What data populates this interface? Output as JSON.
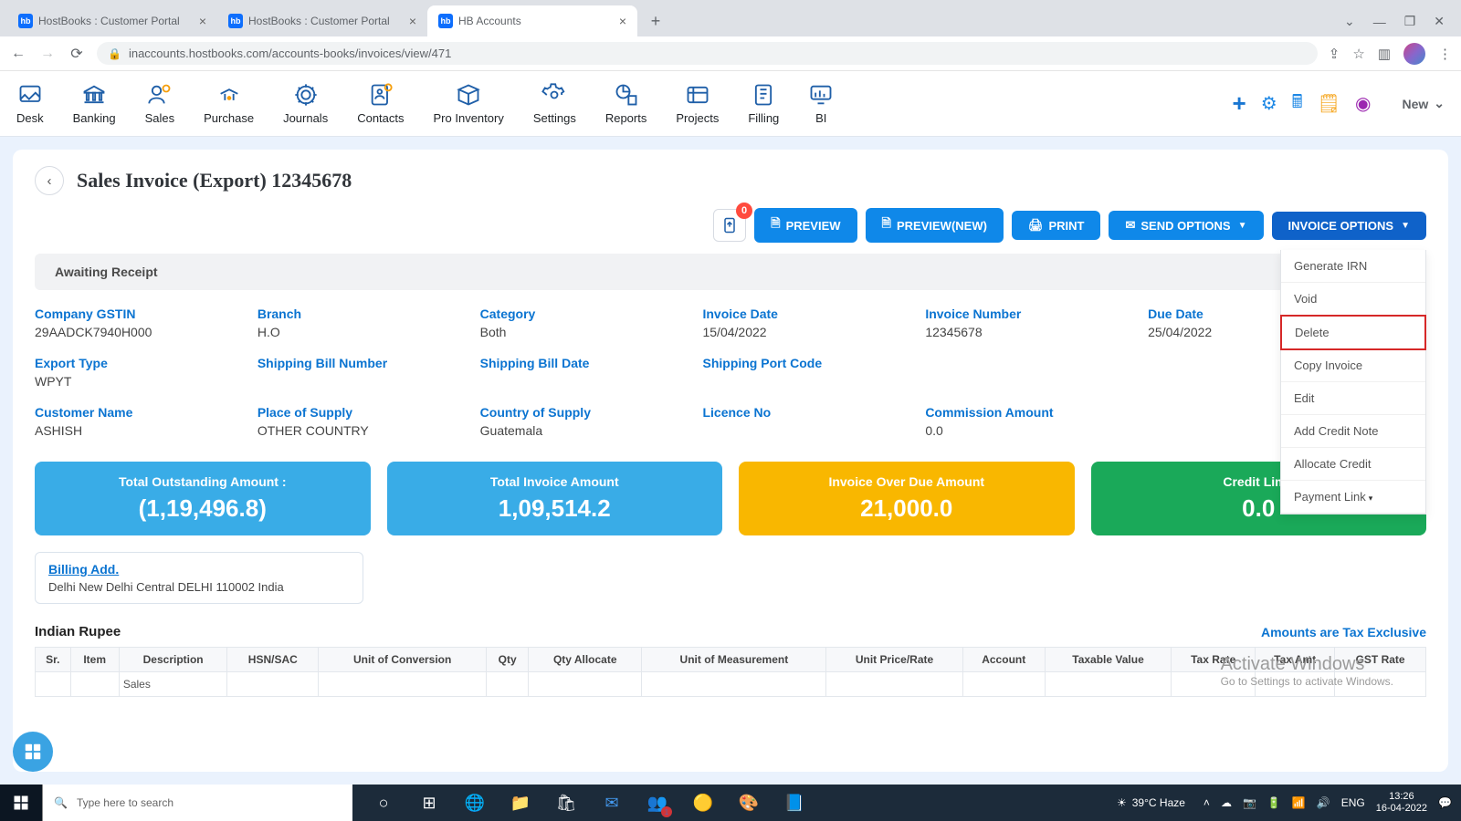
{
  "browser": {
    "tabs": [
      {
        "title": "HostBooks : Customer Portal"
      },
      {
        "title": "HostBooks : Customer Portal"
      },
      {
        "title": "HB Accounts"
      }
    ],
    "url": "inaccounts.hostbooks.com/accounts-books/invoices/view/471"
  },
  "top_nav": {
    "items": [
      "Desk",
      "Banking",
      "Sales",
      "Purchase",
      "Journals",
      "Contacts",
      "Pro Inventory",
      "Settings",
      "Reports",
      "Projects",
      "Filling",
      "BI"
    ],
    "new_label": "New"
  },
  "page": {
    "title": "Sales Invoice (Export) 12345678",
    "attach_badge": "0",
    "buttons": {
      "preview": "PREVIEW",
      "preview_new": "PREVIEW(NEW)",
      "print": "PRINT",
      "send": "SEND OPTIONS",
      "options": "INVOICE OPTIONS"
    },
    "dropdown": [
      "Generate IRN",
      "Void",
      "Delete",
      "Copy Invoice",
      "Edit",
      "Add Credit Note",
      "Allocate Credit",
      "Payment Link"
    ],
    "status": "Awaiting Receipt",
    "fields": {
      "company_gstin": {
        "l": "Company GSTIN",
        "v": "29AADCK7940H000"
      },
      "branch": {
        "l": "Branch",
        "v": "H.O"
      },
      "category": {
        "l": "Category",
        "v": "Both"
      },
      "invoice_date": {
        "l": "Invoice Date",
        "v": "15/04/2022"
      },
      "invoice_number": {
        "l": "Invoice Number",
        "v": "12345678"
      },
      "due_date": {
        "l": "Due Date",
        "v": "25/04/2022"
      },
      "export_type": {
        "l": "Export Type",
        "v": "WPYT"
      },
      "ship_bill_no": {
        "l": "Shipping Bill Number",
        "v": ""
      },
      "ship_bill_date": {
        "l": "Shipping Bill Date",
        "v": ""
      },
      "ship_port": {
        "l": "Shipping Port Code",
        "v": ""
      },
      "customer": {
        "l": "Customer Name",
        "v": "ASHISH"
      },
      "pos": {
        "l": "Place of Supply",
        "v": "OTHER COUNTRY"
      },
      "cos": {
        "l": "Country of Supply",
        "v": "Guatemala"
      },
      "licence": {
        "l": "Licence No",
        "v": ""
      },
      "commission": {
        "l": "Commission Amount",
        "v": "0.0"
      }
    },
    "summary": [
      {
        "t": "Total Outstanding Amount :",
        "v": "(1,19,496.8)",
        "c": "sc-blue"
      },
      {
        "t": "Total Invoice Amount",
        "v": "1,09,514.2",
        "c": "sc-blue"
      },
      {
        "t": "Invoice Over Due Amount",
        "v": "21,000.0",
        "c": "sc-yellow"
      },
      {
        "t": "Credit Limit",
        "v": "0.0",
        "c": "sc-green"
      }
    ],
    "billing": {
      "h": "Billing Add.",
      "a": "Delhi New Delhi Central DELHI 110002 India"
    },
    "currency": "Indian Rupee",
    "tax_note": "Amounts are Tax Exclusive",
    "columns": [
      "Sr.",
      "Item",
      "Description",
      "HSN/SAC",
      "Unit of Conversion",
      "Qty",
      "Qty Allocate",
      "Unit of Measurement",
      "Unit Price/Rate",
      "Account",
      "Taxable Value",
      "Tax Rate",
      "Tax Amt",
      "GST Rate"
    ],
    "row1_desc": "Sales"
  },
  "watermark": {
    "l1": "Activate Windows",
    "l2": "Go to Settings to activate Windows."
  },
  "taskbar": {
    "search_placeholder": "Type here to search",
    "weather": "39°C Haze",
    "lang": "ENG",
    "time": "13:26",
    "date": "16-04-2022"
  }
}
